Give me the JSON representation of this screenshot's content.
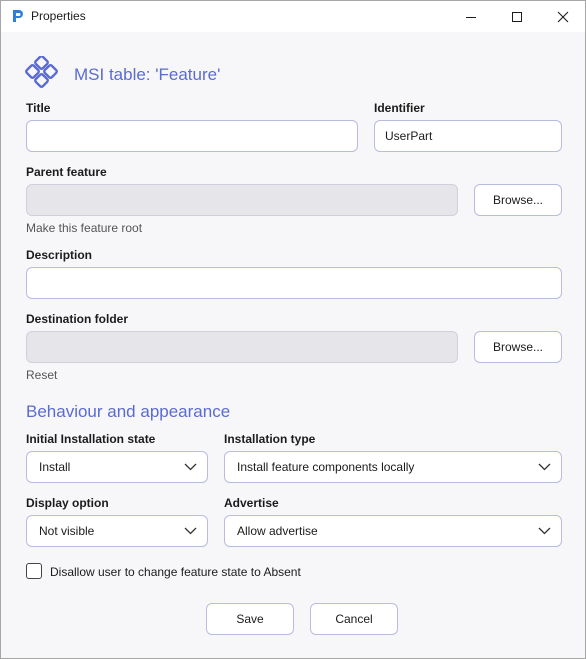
{
  "window": {
    "title": "Properties"
  },
  "header": {
    "title": "MSI table: 'Feature'"
  },
  "fields": {
    "title": {
      "label": "Title",
      "value": ""
    },
    "identifier": {
      "label": "Identifier",
      "value": "UserPart"
    },
    "parent_feature": {
      "label": "Parent feature",
      "value": "",
      "browse_label": "Browse...",
      "link": "Make this feature root"
    },
    "description": {
      "label": "Description",
      "value": ""
    },
    "destination_folder": {
      "label": "Destination folder",
      "value": "",
      "browse_label": "Browse...",
      "link": "Reset"
    }
  },
  "behaviour": {
    "heading": "Behaviour and appearance",
    "initial_state": {
      "label": "Initial Installation state",
      "value": "Install"
    },
    "installation_type": {
      "label": "Installation type",
      "value": "Install feature components locally"
    },
    "display_option": {
      "label": "Display option",
      "value": "Not visible"
    },
    "advertise": {
      "label": "Advertise",
      "value": "Allow advertise"
    },
    "disallow_absent": {
      "label": "Disallow user to change feature state to Absent",
      "checked": false
    }
  },
  "actions": {
    "save_label": "Save",
    "cancel_label": "Cancel"
  },
  "colors": {
    "accent": "#5a6bd2",
    "border": "#b9bbe0",
    "disabled_fill": "#e6e6ea"
  }
}
